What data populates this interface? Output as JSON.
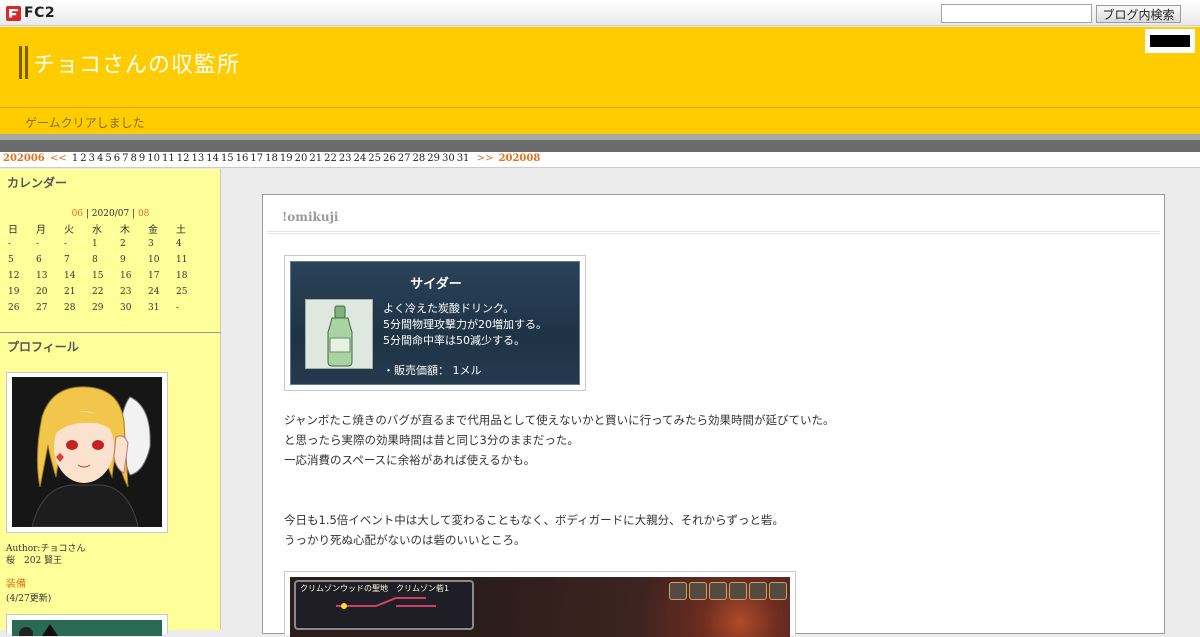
{
  "topbar": {
    "logo_text": "FC2",
    "search_value": "",
    "search_button": "ブログ内検索"
  },
  "header": {
    "site_title": "チョコさんの収監所",
    "site_description": "ゲームクリアしました"
  },
  "datenav": {
    "prev_month": "202006",
    "prev_arrow": "<<",
    "days": [
      "1",
      "2",
      "3",
      "4",
      "5",
      "6",
      "7",
      "8",
      "9",
      "10",
      "11",
      "12",
      "13",
      "14",
      "15",
      "16",
      "17",
      "18",
      "19",
      "20",
      "21",
      "22",
      "23",
      "24",
      "25",
      "26",
      "27",
      "28",
      "29",
      "30",
      "31"
    ],
    "next_arrow": ">>",
    "next_month": "202008"
  },
  "sidebar": {
    "calendar": {
      "title": "カレンダー",
      "prev": "06",
      "sep1": " | ",
      "current": "2020/07",
      "sep2": " | ",
      "next": "08",
      "weekdays": [
        "日",
        "月",
        "火",
        "水",
        "木",
        "金",
        "土"
      ],
      "weeks": [
        [
          "-",
          "-",
          "-",
          "1",
          "2",
          "3",
          "4"
        ],
        [
          "5",
          "6",
          "7",
          "8",
          "9",
          "10",
          "11"
        ],
        [
          "12",
          "13",
          "14",
          "15",
          "16",
          "17",
          "18"
        ],
        [
          "19",
          "20",
          "21",
          "22",
          "23",
          "24",
          "25"
        ],
        [
          "26",
          "27",
          "28",
          "29",
          "30",
          "31",
          "-"
        ]
      ]
    },
    "profile": {
      "title": "プロフィール",
      "author_line": "Author:チョコさん",
      "server_line": "桜　202 賢王",
      "equip_link": "装備",
      "equip_date": "(4/27更新)"
    }
  },
  "entry": {
    "title": "!omikuji",
    "item_card": {
      "name": "サイダー",
      "line1": "よく冷えた炭酸ドリンク。",
      "line2": "5分間物理攻撃力が20増加する。",
      "line3": "5分間命中率は50減少する。",
      "price": "・販売価額： 1メル"
    },
    "paragraph1": [
      "ジャンボたこ焼きのバグが直るまで代用品として使えないかと買いに行ってみたら効果時間が延びていた。",
      "と思ったら実際の効果時間は昔と同じ3分のままだった。",
      "一応消費のスペースに余裕があれば使えるかも。"
    ],
    "paragraph2": [
      "今日も1.5倍イベント中は大して変わることもなく、ボディガードに大親分、それからずっと砦。",
      "うっかり死ぬ心配がないのは砦のいいところ。"
    ],
    "screenshot2_label": "クリムゾンウッドの聖地　クリムゾン砦1"
  },
  "colors": {
    "header_yellow": "#ffcc00",
    "sidebar_yellow": "#ffff99",
    "accent_orange": "#e2701e"
  }
}
